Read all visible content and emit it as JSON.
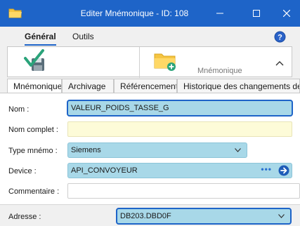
{
  "window": {
    "title": "Editer Mnémonique - ID: 108"
  },
  "ribbon": {
    "tabs": [
      "Général",
      "Outils"
    ],
    "mnemonique_label": "Mnémonique"
  },
  "detail_tabs": [
    "Mnémonique",
    "Archivage",
    "Référencement",
    "Historique des changements de valeur"
  ],
  "form": {
    "nom": {
      "label": "Nom :",
      "value": "VALEUR_POIDS_TASSE_G"
    },
    "nom_complet": {
      "label": "Nom complet :",
      "value": ""
    },
    "type_mnemo": {
      "label": "Type mnémo :",
      "value": "Siemens"
    },
    "device": {
      "label": "Device :",
      "value": "API_CONVOYEUR",
      "browse": "•••"
    },
    "commentaire": {
      "label": "Commentaire :",
      "value": ""
    },
    "adresse": {
      "label": "Adresse :",
      "value": "DB203.DBD0F"
    }
  },
  "colors": {
    "titlebar": "#1e64c8",
    "field_blue": "#a8d8e8",
    "field_yellow": "#fdfbd8",
    "save_check": "#2aa37a"
  }
}
